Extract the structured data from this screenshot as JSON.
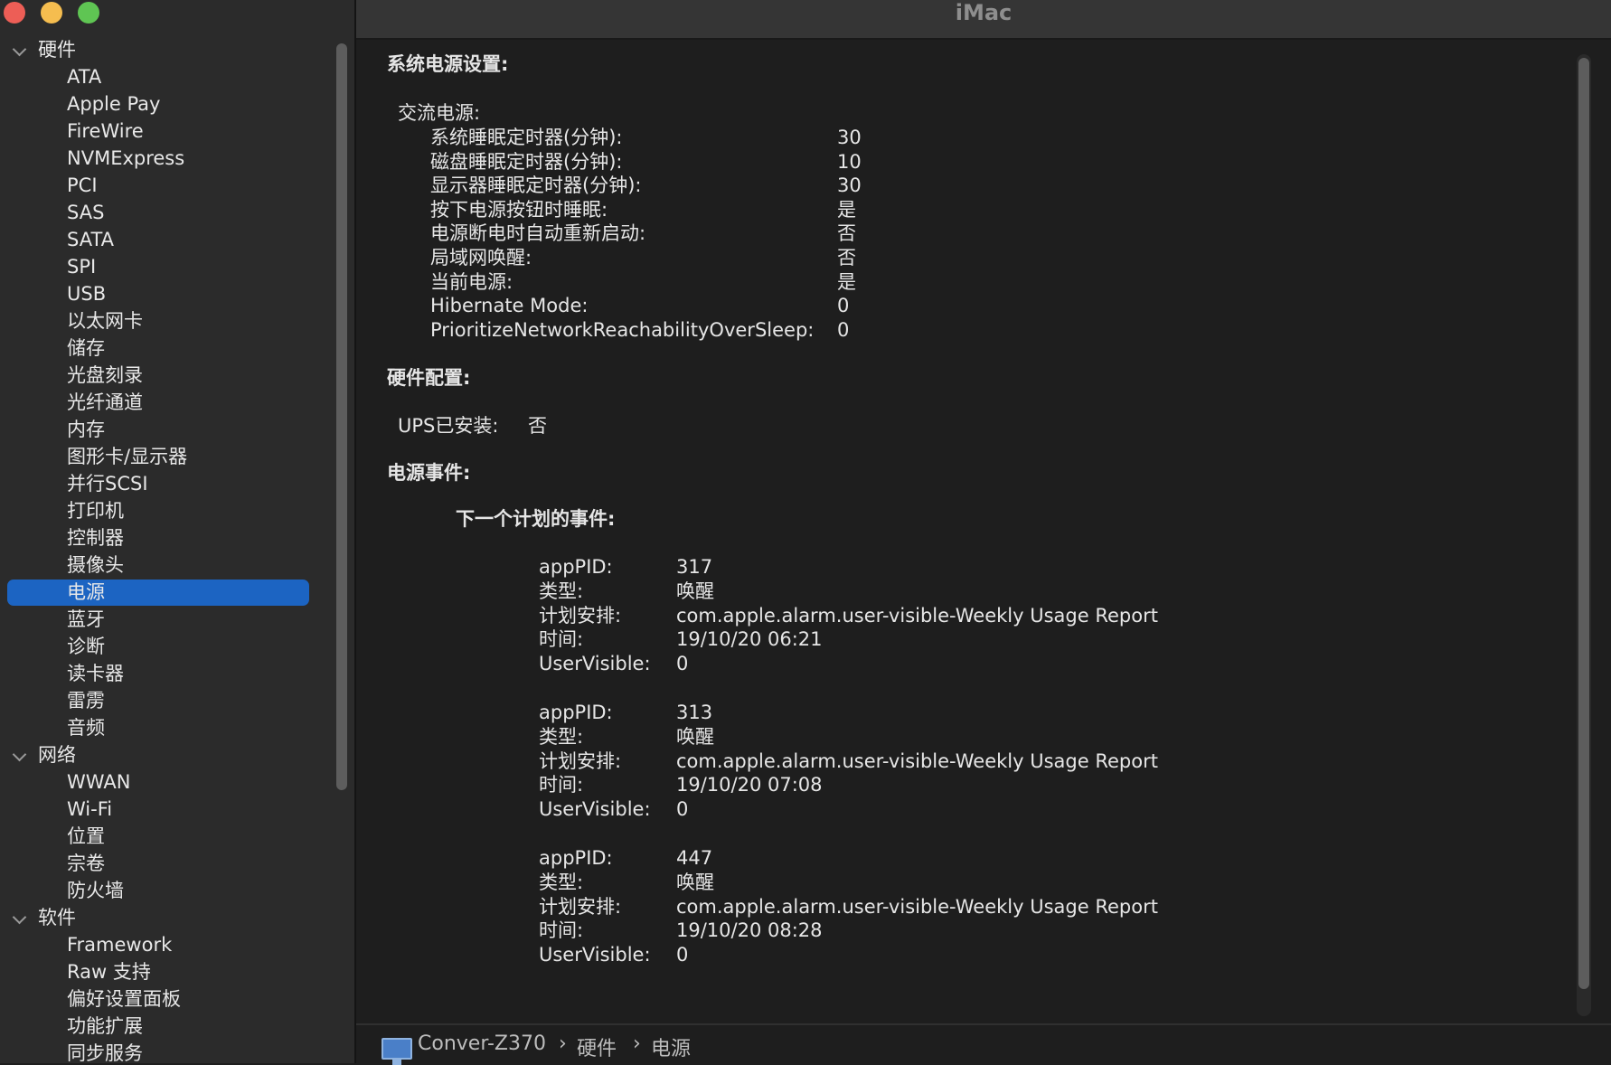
{
  "window": {
    "title": "iMac"
  },
  "sidebar": {
    "groups": [
      {
        "label": "硬件",
        "items": [
          "ATA",
          "Apple Pay",
          "FireWire",
          "NVMExpress",
          "PCI",
          "SAS",
          "SATA",
          "SPI",
          "USB",
          "以太网卡",
          "储存",
          "光盘刻录",
          "光纤通道",
          "内存",
          "图形卡/显示器",
          "并行SCSI",
          "打印机",
          "控制器",
          "摄像头",
          "电源",
          "蓝牙",
          "诊断",
          "读卡器",
          "雷雳",
          "音频"
        ]
      },
      {
        "label": "网络",
        "items": [
          "WWAN",
          "Wi-Fi",
          "位置",
          "宗卷",
          "防火墙"
        ]
      },
      {
        "label": "软件",
        "items": [
          "Framework",
          "Raw 支持",
          "偏好设置面板",
          "功能扩展",
          "同步服务"
        ]
      }
    ],
    "selected": "电源"
  },
  "content": {
    "system_power": {
      "heading": "系统电源设置:",
      "ac_label": "交流电源:",
      "rows": [
        {
          "label": "系统睡眠定时器(分钟):",
          "value": "30"
        },
        {
          "label": "磁盘睡眠定时器(分钟):",
          "value": "10"
        },
        {
          "label": "显示器睡眠定时器(分钟):",
          "value": "30"
        },
        {
          "label": "按下电源按钮时睡眠:",
          "value": "是"
        },
        {
          "label": "电源断电时自动重新启动:",
          "value": "否"
        },
        {
          "label": "局域网唤醒:",
          "value": "否"
        },
        {
          "label": "当前电源:",
          "value": "是"
        },
        {
          "label": "Hibernate Mode:",
          "value": "0"
        },
        {
          "label": "PrioritizeNetworkReachabilityOverSleep:",
          "value": "0"
        }
      ]
    },
    "hardware_config": {
      "heading": "硬件配置:",
      "ups_label": "UPS已安装:",
      "ups_value": "否"
    },
    "power_events": {
      "heading": "电源事件:",
      "next_label": "下一个计划的事件:",
      "field_labels": {
        "appPID": "appPID:",
        "type": "类型:",
        "schedule": "计划安排:",
        "time": "时间:",
        "visible": "UserVisible:"
      },
      "events": [
        {
          "appPID": "317",
          "type": "唤醒",
          "schedule": "com.apple.alarm.user-visible-Weekly Usage Report",
          "time": "19/10/20 06:21",
          "visible": "0"
        },
        {
          "appPID": "313",
          "type": "唤醒",
          "schedule": "com.apple.alarm.user-visible-Weekly Usage Report",
          "time": "19/10/20 07:08",
          "visible": "0"
        },
        {
          "appPID": "447",
          "type": "唤醒",
          "schedule": "com.apple.alarm.user-visible-Weekly Usage Report",
          "time": "19/10/20 08:28",
          "visible": "0"
        }
      ]
    }
  },
  "pathbar": {
    "computer": "Conver-Z370",
    "sep": "›",
    "category": "硬件",
    "item": "电源"
  },
  "colors": {
    "selection": "#1c64c2",
    "close": "#ed5e56",
    "minimize": "#f5bd4f",
    "zoom": "#5fc553"
  }
}
